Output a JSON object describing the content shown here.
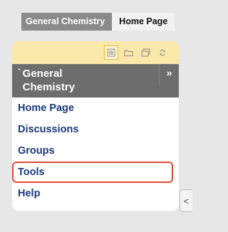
{
  "breadcrumb": {
    "course": "General Chemistry",
    "page": "Home Page"
  },
  "panel": {
    "toolbar_icons": [
      "list-view-icon",
      "folder-icon",
      "window-icon",
      "refresh-icon"
    ],
    "title_caret": "ˆ",
    "course_title": "General Chemistry",
    "expand_symbol": "»",
    "menu": [
      {
        "label": "Home Page"
      },
      {
        "label": "Discussions"
      },
      {
        "label": "Groups"
      },
      {
        "label": "Tools"
      },
      {
        "label": "Help"
      }
    ]
  },
  "collapse_symbol": "<",
  "colors": {
    "highlight_outline": "#e0473a",
    "link": "#1a3a7a",
    "toolbar_bg": "#fbe9a9",
    "header_bg": "#6d6d6d"
  }
}
